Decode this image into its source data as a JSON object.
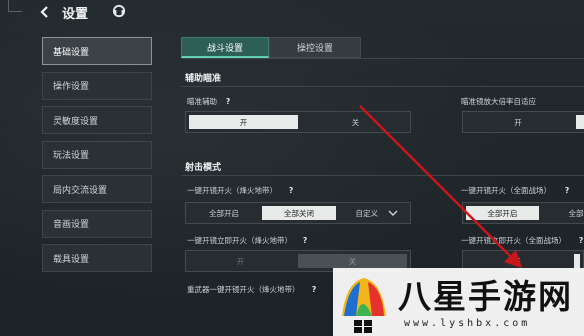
{
  "header": {
    "title": "设置"
  },
  "sidebar": {
    "items": [
      {
        "label": "基础设置"
      },
      {
        "label": "操作设置"
      },
      {
        "label": "灵敏度设置"
      },
      {
        "label": "玩法设置"
      },
      {
        "label": "局内交流设置"
      },
      {
        "label": "音画设置"
      },
      {
        "label": "载具设置"
      }
    ]
  },
  "tabs": [
    {
      "label": "战斗设置"
    },
    {
      "label": "操控设置"
    }
  ],
  "aim_section": {
    "title": "辅助瞄准",
    "aim_assist": {
      "label": "瞄准辅助",
      "help": "?",
      "on": "开",
      "off": "关"
    },
    "scope_adapt": {
      "label": "瞄准镜放大倍率自适应",
      "on": "开"
    }
  },
  "fire_section": {
    "title": "射击模式",
    "one_key_fire_beacon": {
      "label": "一键开镜开火（烽火地带）",
      "help": "?",
      "opt_all_on": "全部开启",
      "opt_all_off": "全部关闭",
      "opt_custom": "自定义"
    },
    "one_key_fire_full": {
      "label": "一键开镜开火（全面战场）",
      "help": "?",
      "opt_all_on": "全部开启",
      "opt_all_off": "全部关"
    },
    "instant_fire_beacon": {
      "label": "一键开镜立即开火（烽火地带）",
      "help": "?",
      "on": "开",
      "off": "关"
    },
    "instant_fire_full": {
      "label": "一键开镜立即开火（全面战场）",
      "help": "?",
      "on": "开"
    },
    "heavy_weapon_beacon": {
      "label": "重武器一键开镜开火（烽火地带）",
      "help": "?"
    }
  },
  "watermark": {
    "brand": "八星手游网",
    "url": "www.lyshbx.com"
  },
  "colors": {
    "accent": "#5fd0b4",
    "active_toggle": "#e8eaea",
    "annotation_arrow": "#c8171b"
  }
}
